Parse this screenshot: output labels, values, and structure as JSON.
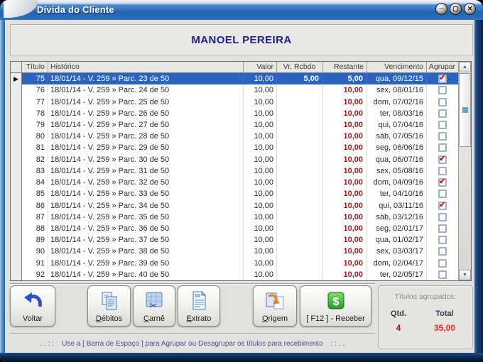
{
  "window": {
    "title": "Dívida do Cliente"
  },
  "client_name": "MANOEL PEREIRA",
  "table": {
    "columns": [
      "Título",
      "Histórico",
      "Valor",
      "Vr. Rcbdo",
      "Restante",
      "Vencimento",
      "Agrupar"
    ],
    "rows": [
      {
        "titulo": "75",
        "historico": "18/01/14 - V. 259 » Parc. 23 de 50",
        "valor": "10,00",
        "rcbdo": "5,00",
        "restante": "5,00",
        "vencimento": "qua, 09/12/15",
        "agrupar": true,
        "selected": true
      },
      {
        "titulo": "76",
        "historico": "18/01/14 - V. 259 » Parc. 24 de 50",
        "valor": "10,00",
        "rcbdo": "",
        "restante": "10,00",
        "vencimento": "sex, 08/01/16",
        "agrupar": false,
        "selected": false
      },
      {
        "titulo": "77",
        "historico": "18/01/14 - V. 259 » Parc. 25 de 50",
        "valor": "10,00",
        "rcbdo": "",
        "restante": "10,00",
        "vencimento": "dom, 07/02/16",
        "agrupar": false,
        "selected": false
      },
      {
        "titulo": "78",
        "historico": "18/01/14 - V. 259 » Parc. 26 de 50",
        "valor": "10,00",
        "rcbdo": "",
        "restante": "10,00",
        "vencimento": "ter, 08/03/16",
        "agrupar": false,
        "selected": false
      },
      {
        "titulo": "79",
        "historico": "18/01/14 - V. 259 » Parc. 27 de 50",
        "valor": "10,00",
        "rcbdo": "",
        "restante": "10,00",
        "vencimento": "qui, 07/04/16",
        "agrupar": false,
        "selected": false
      },
      {
        "titulo": "80",
        "historico": "18/01/14 - V. 259 » Parc. 28 de 50",
        "valor": "10,00",
        "rcbdo": "",
        "restante": "10,00",
        "vencimento": "sáb, 07/05/16",
        "agrupar": false,
        "selected": false
      },
      {
        "titulo": "81",
        "historico": "18/01/14 - V. 259 » Parc. 29 de 50",
        "valor": "10,00",
        "rcbdo": "",
        "restante": "10,00",
        "vencimento": "seg, 06/06/16",
        "agrupar": false,
        "selected": false
      },
      {
        "titulo": "82",
        "historico": "18/01/14 - V. 259 » Parc. 30 de 50",
        "valor": "10,00",
        "rcbdo": "",
        "restante": "10,00",
        "vencimento": "qua, 06/07/16",
        "agrupar": true,
        "selected": false
      },
      {
        "titulo": "83",
        "historico": "18/01/14 - V. 259 » Parc. 31 de 50",
        "valor": "10,00",
        "rcbdo": "",
        "restante": "10,00",
        "vencimento": "sex, 05/08/16",
        "agrupar": false,
        "selected": false
      },
      {
        "titulo": "84",
        "historico": "18/01/14 - V. 259 » Parc. 32 de 50",
        "valor": "10,00",
        "rcbdo": "",
        "restante": "10,00",
        "vencimento": "dom, 04/09/16",
        "agrupar": true,
        "selected": false
      },
      {
        "titulo": "85",
        "historico": "18/01/14 - V. 259 » Parc. 33 de 50",
        "valor": "10,00",
        "rcbdo": "",
        "restante": "10,00",
        "vencimento": "ter, 04/10/16",
        "agrupar": false,
        "selected": false
      },
      {
        "titulo": "86",
        "historico": "18/01/14 - V. 259 » Parc. 34 de 50",
        "valor": "10,00",
        "rcbdo": "",
        "restante": "10,00",
        "vencimento": "qui, 03/11/16",
        "agrupar": true,
        "selected": false
      },
      {
        "titulo": "87",
        "historico": "18/01/14 - V. 259 » Parc. 35 de 50",
        "valor": "10,00",
        "rcbdo": "",
        "restante": "10,00",
        "vencimento": "sáb, 03/12/16",
        "agrupar": false,
        "selected": false
      },
      {
        "titulo": "88",
        "historico": "18/01/14 - V. 259 » Parc. 36 de 50",
        "valor": "10,00",
        "rcbdo": "",
        "restante": "10,00",
        "vencimento": "seg, 02/01/17",
        "agrupar": false,
        "selected": false
      },
      {
        "titulo": "89",
        "historico": "18/01/14 - V. 259 » Parc. 37 de 50",
        "valor": "10,00",
        "rcbdo": "",
        "restante": "10,00",
        "vencimento": "qua, 01/02/17",
        "agrupar": false,
        "selected": false
      },
      {
        "titulo": "90",
        "historico": "18/01/14 - V. 259 » Parc. 38 de 50",
        "valor": "10,00",
        "rcbdo": "",
        "restante": "10,00",
        "vencimento": "sex, 03/03/17",
        "agrupar": false,
        "selected": false
      },
      {
        "titulo": "91",
        "historico": "18/01/14 - V. 259 » Parc. 39 de 50",
        "valor": "10,00",
        "rcbdo": "",
        "restante": "10,00",
        "vencimento": "dom, 02/04/17",
        "agrupar": false,
        "selected": false
      },
      {
        "titulo": "92",
        "historico": "18/01/14 - V. 259 » Parc. 40 de 50",
        "valor": "10,00",
        "rcbdo": "",
        "restante": "10,00",
        "vencimento": "ter, 02/05/17",
        "agrupar": false,
        "selected": false
      }
    ]
  },
  "buttons": [
    {
      "label": "Voltar",
      "underline": false
    },
    {
      "label": "Débitos",
      "underline": true
    },
    {
      "label": "Carnê",
      "underline": true
    },
    {
      "label": "Extrato",
      "underline": true
    },
    {
      "label": "Origem",
      "underline": true
    },
    {
      "label": "[ F12 ] - Receber",
      "underline": false
    }
  ],
  "summary": {
    "title": "Títulos agrupados:",
    "qtd_label": "Qtd.",
    "total_label": "Total",
    "qtd": "4",
    "total": "35,00"
  },
  "status": ". . : :    Use a [ Barra de Espaço ] para Agrupar ou Desagrupar os títulos para recebimento    : : . .",
  "colors": {
    "titlebar_blue": "#3e7ec4",
    "selected_row": "#2b63c1",
    "restante_red": "#9c1a1a",
    "total_red": "#ff2626",
    "check_red": "#e01212",
    "client_navy": "#1e1e8e"
  }
}
